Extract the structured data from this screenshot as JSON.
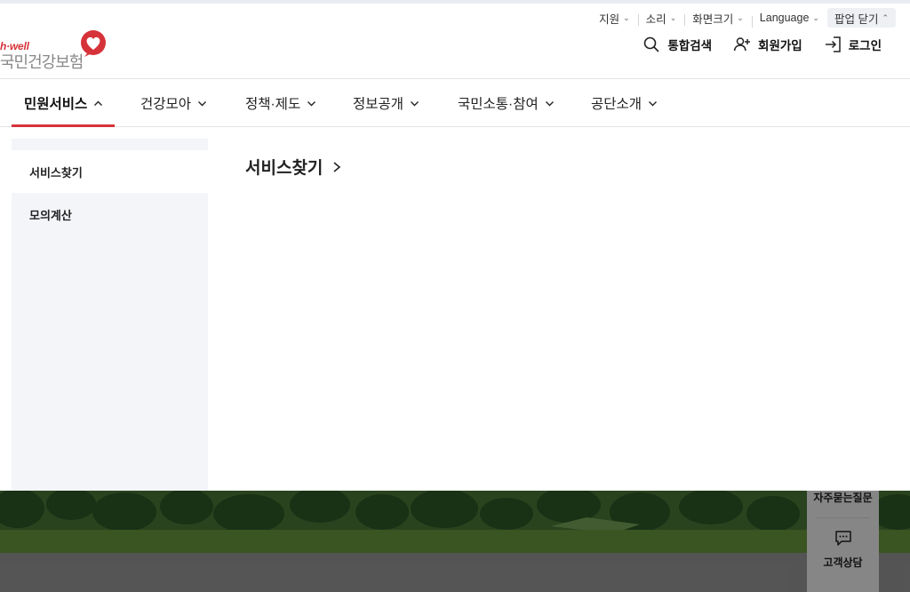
{
  "utility": {
    "items": [
      {
        "label": "지원"
      },
      {
        "label": "소리"
      },
      {
        "label": "화면크기"
      },
      {
        "label": "Language"
      }
    ],
    "popup_close": "팝업 닫기"
  },
  "logo": {
    "tagline": "h·well",
    "name": "국민건강보험",
    "accent": "#d6323a"
  },
  "header": {
    "search": "통합검색",
    "join": "회원가입",
    "login": "로그인"
  },
  "gnb": {
    "items": [
      {
        "label": "민원서비스",
        "active": true
      },
      {
        "label": "건강모아"
      },
      {
        "label": "정책·제도"
      },
      {
        "label": "정보공개"
      },
      {
        "label": "국민소통·참여"
      },
      {
        "label": "공단소개"
      }
    ]
  },
  "submenu": {
    "side_items": [
      {
        "label": "서비스찾기"
      },
      {
        "label": "모의계산"
      }
    ],
    "title": "서비스찾기"
  },
  "quick_menu": {
    "faq": "자주묻는질문",
    "consult": "고객상담"
  }
}
